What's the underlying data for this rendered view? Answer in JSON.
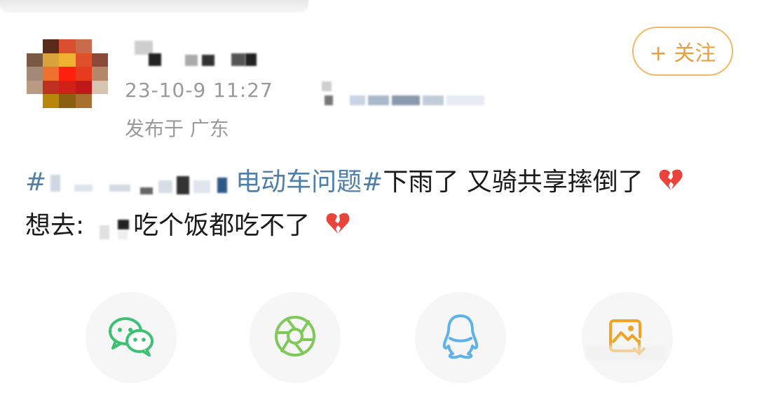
{
  "post": {
    "timestamp": "23-10-9 11:27",
    "location": "发布于 广东",
    "follow_label": "+ 关注",
    "topic_start": "#",
    "topic_end": "电动车问题#",
    "line1_text": "下雨了  又骑共享摔倒了",
    "line2_prefix": "想去:",
    "line2_text": "吃个饭都吃不了",
    "emoji_name": "broken-heart-icon"
  },
  "share": {
    "items": [
      "wechat-icon",
      "moments-icon",
      "qq-icon",
      "save-image-icon"
    ]
  },
  "colors": {
    "topic": "#4e7fa8",
    "follow": "#e8a03e",
    "meta": "#9a9a9a",
    "wechat": "#3cc073",
    "moments": "#7fc85a",
    "qq": "#5fb2e8",
    "save": "#f0a324"
  }
}
